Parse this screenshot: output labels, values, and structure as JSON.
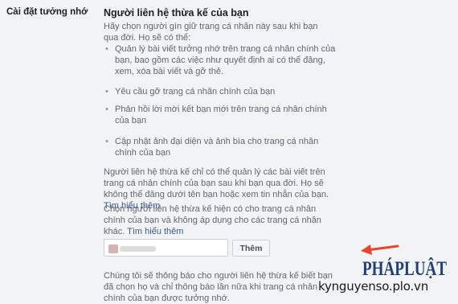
{
  "sidebar": {
    "section_label": "Cài đặt tưởng nhớ"
  },
  "legacy_contact": {
    "title": "Người liên hệ thừa kế của bạn",
    "intro": "Hãy chọn người gìn giữ trang cá nhân này sau khi bạn qua đời. Họ sẽ có thể:",
    "abilities": [
      "Quản lý bài viết tưởng nhớ trên trang cá nhân chính của bạn, bao gồm các việc như quyết định ai có thể đăng, xem, xóa bài viết và gỡ thẻ.",
      "Yêu cầu gỡ trang cá nhân chính của bạn",
      "Phản hồi lời mời kết bạn mới trên trang cá nhân chính của bạn",
      "Cập nhật ảnh đại diện và ảnh bìa cho trang cá nhân chính của bạn"
    ],
    "limitation_text": "Người liên hệ thừa kế chỉ có thể quản lý các bài viết trên trang cá nhân chính của bạn sau khi bạn qua đời. Họ sẽ không thể đăng dưới tên bạn hoặc xem tin nhắn của bạn.",
    "limitation_link": "Tìm hiểu thêm",
    "scope_text": "Chọn người liên hệ thừa kế hiện có cho trang cá nhân chính của bạn và không áp dụng cho các trang cá nhân khác.",
    "scope_link": "Tìm hiểu thêm",
    "add_button": "Thêm",
    "notify_text": "Chúng tôi sẽ thông báo cho người liên hệ thừa kế biết bạn đã chọn họ và chỉ thông báo lần nữa khi trang cá nhân chính của bạn được tưởng nhớ."
  },
  "watermark": {
    "logo_text": "PHÁPLUẬT",
    "url": "kynguyenso.plo.vn"
  },
  "colors": {
    "background": "#f2f3f5",
    "link": "#385898",
    "arrow": "#e8452c",
    "logo": "#1f3f7a"
  }
}
